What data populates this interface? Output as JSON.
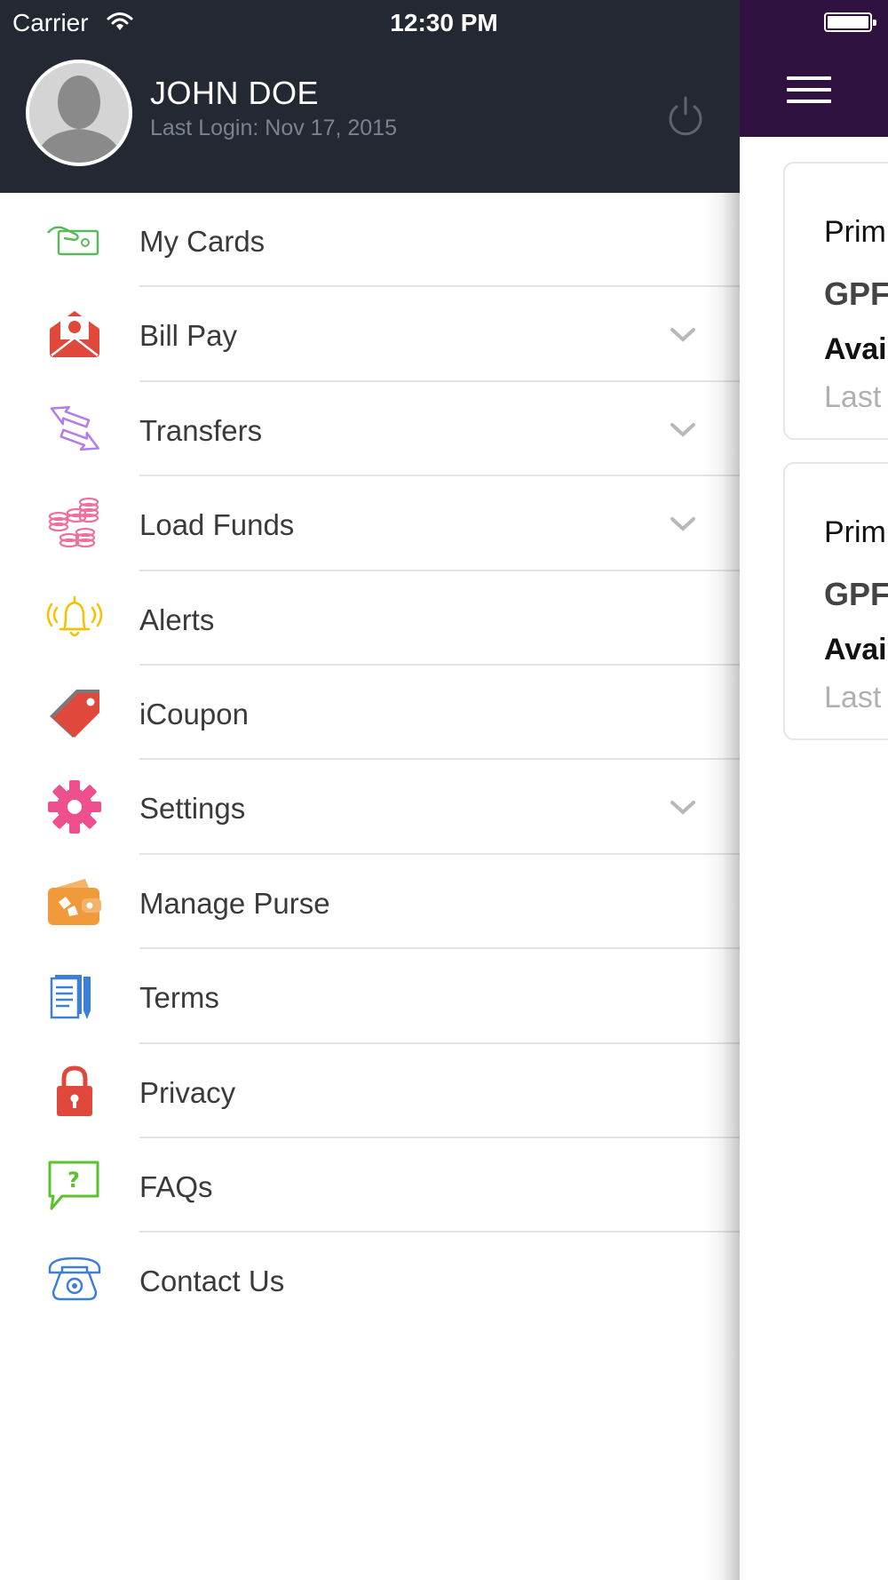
{
  "status_bar": {
    "carrier": "Carrier",
    "time": "12:30 PM"
  },
  "user": {
    "name": "JOHN DOE",
    "last_login": "Last Login: Nov 17, 2015"
  },
  "menu": {
    "items": [
      {
        "label": "My Cards",
        "icon": "card-hand-icon",
        "color": "#5cb85c",
        "expandable": false
      },
      {
        "label": "Bill Pay",
        "icon": "bill-envelope-icon",
        "color": "#e0483b",
        "expandable": true
      },
      {
        "label": "Transfers",
        "icon": "transfer-arrows-icon",
        "color": "#b57be6",
        "expandable": true
      },
      {
        "label": "Load Funds",
        "icon": "coins-icon",
        "color": "#ef6f9a",
        "expandable": true
      },
      {
        "label": "Alerts",
        "icon": "bell-icon",
        "color": "#f2c200",
        "expandable": false
      },
      {
        "label": "iCoupon",
        "icon": "tag-icon",
        "color": "#e0483b",
        "expandable": false
      },
      {
        "label": "Settings",
        "icon": "gear-icon",
        "color": "#ee4f8e",
        "expandable": true
      },
      {
        "label": "Manage Purse",
        "icon": "wallet-icon",
        "color": "#f09a3c",
        "expandable": false
      },
      {
        "label": "Terms",
        "icon": "document-pen-icon",
        "color": "#3d7ed8",
        "expandable": false
      },
      {
        "label": "Privacy",
        "icon": "lock-icon",
        "color": "#e0483b",
        "expandable": false
      },
      {
        "label": "FAQs",
        "icon": "question-bubble-icon",
        "color": "#5cc22c",
        "expandable": false
      },
      {
        "label": "Contact Us",
        "icon": "telephone-icon",
        "color": "#3d7ed8",
        "expandable": false
      }
    ]
  },
  "main": {
    "header_color": "#2f1240",
    "cards": [
      {
        "title": "Prim",
        "type": "GPF",
        "available": "Avai",
        "last": "Last"
      },
      {
        "title": "Prim",
        "type": "GPF",
        "available": "Avai",
        "last": "Last"
      }
    ]
  },
  "colors": {
    "drawer_header": "#232832",
    "separator": "#e4e4e4",
    "chevron": "#b8b8b8"
  }
}
